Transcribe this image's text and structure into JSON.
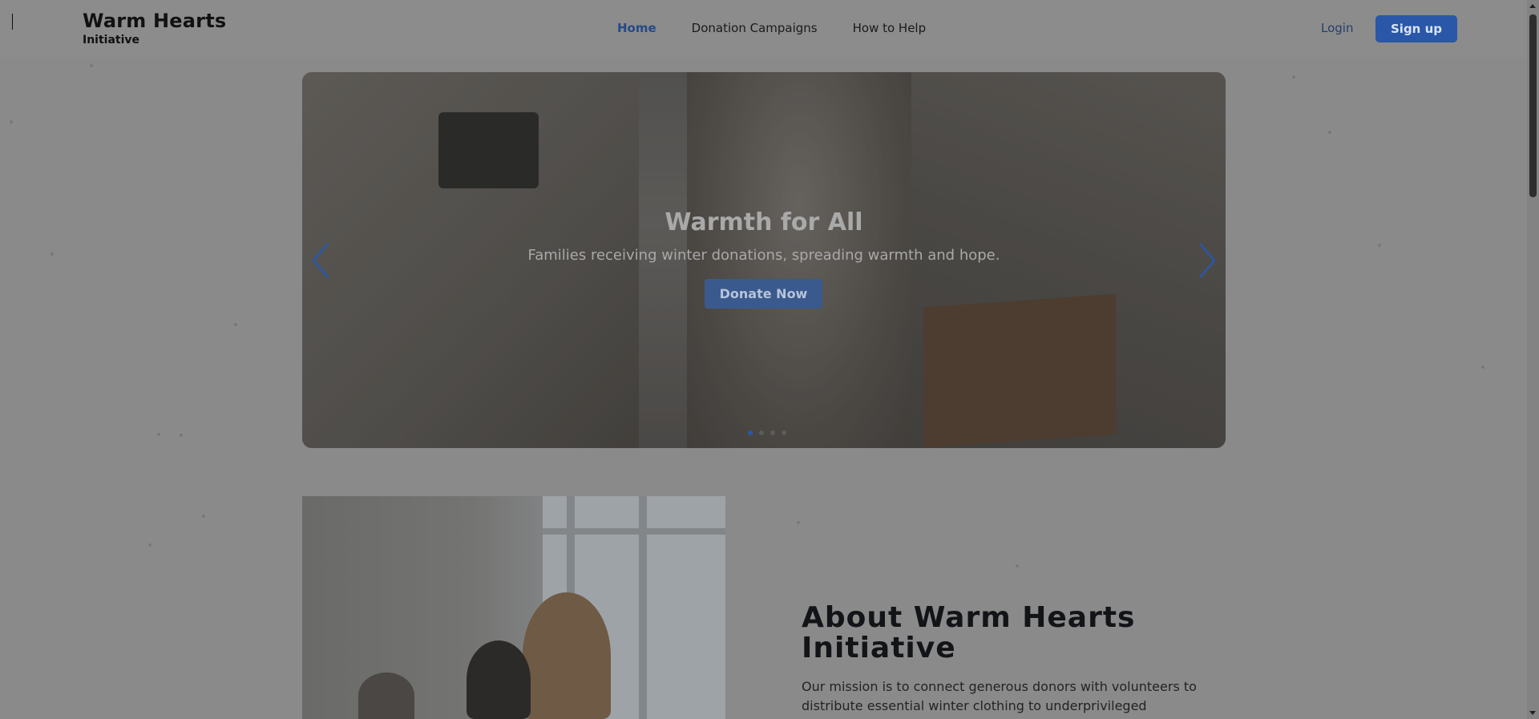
{
  "header": {
    "brand_title": "Warm Hearts",
    "brand_subtitle": "Initiative",
    "nav": [
      {
        "label": "Home"
      },
      {
        "label": "Donation Campaigns"
      },
      {
        "label": "How to Help"
      }
    ],
    "login_label": "Login",
    "signup_label": "Sign up"
  },
  "hero": {
    "title": "Warmth for All",
    "subtitle": "Families receiving winter donations, spreading warmth and hope.",
    "cta_label": "Donate Now",
    "slide_count": 4,
    "active_slide": 1
  },
  "about": {
    "title_line1": "About Warm Hearts",
    "title_line2": "Initiative",
    "text": "Our mission is to connect generous donors with volunteers to distribute essential winter clothing to underprivileged"
  },
  "colors": {
    "accent": "#2a57a8",
    "nav_active": "#244a88"
  }
}
